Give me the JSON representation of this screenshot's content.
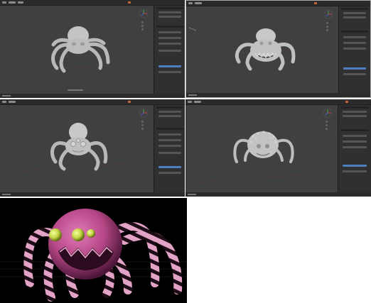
{
  "screenshot": {
    "panels": [
      {
        "name": "viewport-panel-1",
        "variant": "spider-front-smooth"
      },
      {
        "name": "viewport-panel-2",
        "variant": "spider-mouth-teeth"
      },
      {
        "name": "viewport-panel-3",
        "variant": "spider-eyes-face"
      },
      {
        "name": "viewport-panel-4",
        "variant": "spider-spiky-body"
      }
    ],
    "render": {
      "name": "rendered-spider",
      "colors": {
        "body": "#c0508f",
        "body_dark": "#5a1c43",
        "leg_stripe_light": "#e5a8cc",
        "leg_stripe_dark": "#241019",
        "eyes": "#c8d84a",
        "background": "#000000"
      }
    },
    "colors": {
      "blender_bg": "#3d3d3d",
      "blender_topbar": "#2b2b2b",
      "blender_accent": "#4d7fc0",
      "clay": "#c8c8c8"
    },
    "icons": [
      "gizmo-icon",
      "nav-buttons-icon",
      "menu-icon"
    ]
  }
}
